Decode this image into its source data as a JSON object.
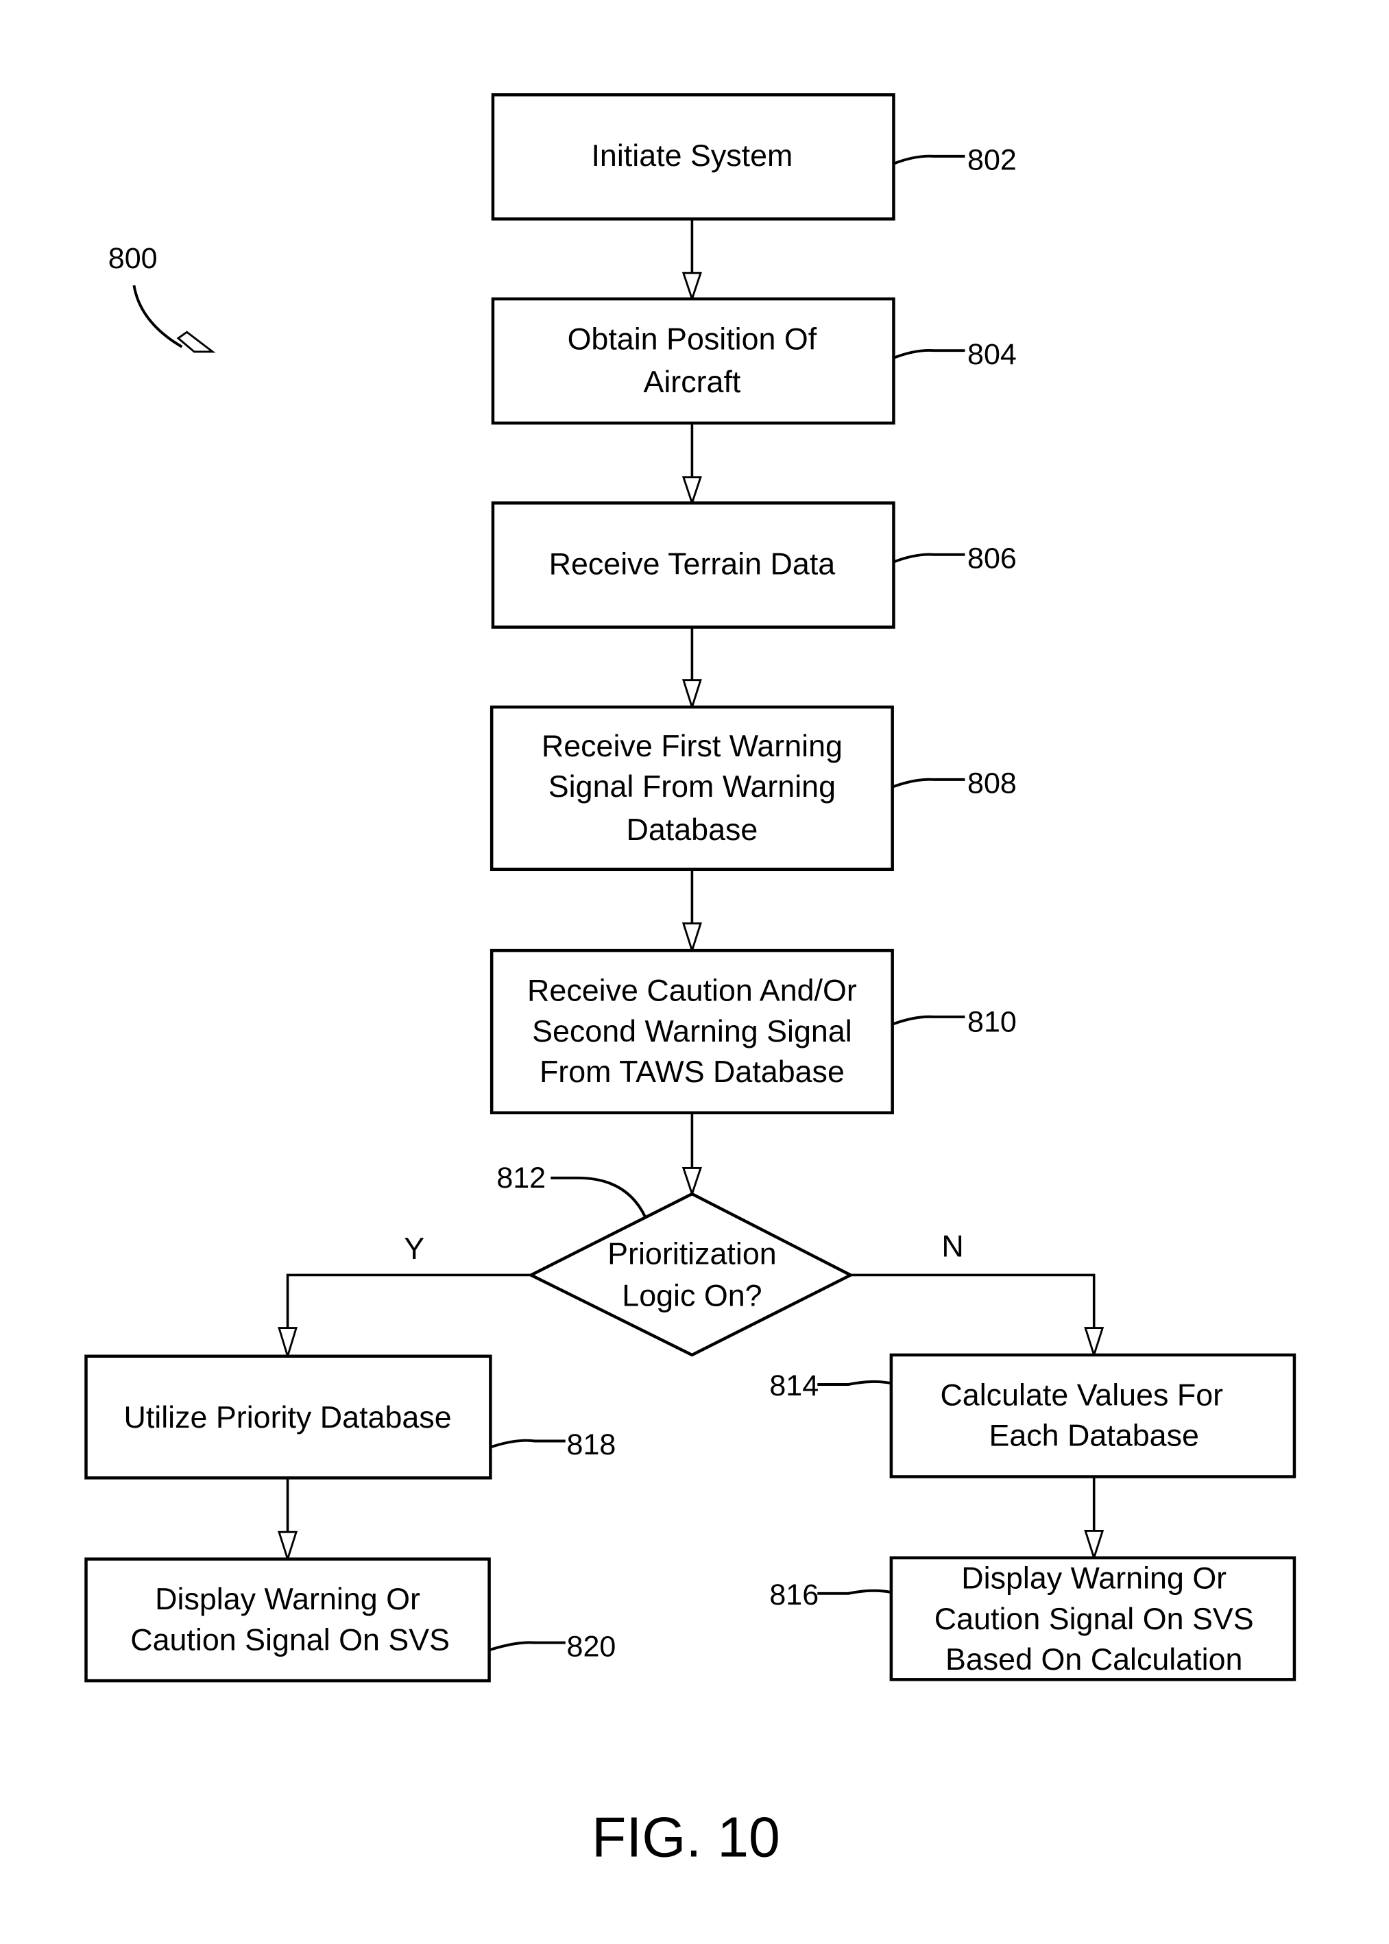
{
  "figure": {
    "label": "FIG. 10",
    "ref": "800"
  },
  "steps": {
    "s802": {
      "ref": "802",
      "lines": [
        "Initiate System"
      ]
    },
    "s804": {
      "ref": "804",
      "lines": [
        "Obtain Position Of",
        "Aircraft"
      ]
    },
    "s806": {
      "ref": "806",
      "lines": [
        "Receive Terrain Data"
      ]
    },
    "s808": {
      "ref": "808",
      "lines": [
        "Receive First Warning",
        "Signal From Warning",
        "Database"
      ]
    },
    "s810": {
      "ref": "810",
      "lines": [
        "Receive Caution And/Or",
        "Second Warning Signal",
        "From TAWS Database"
      ]
    },
    "s812": {
      "ref": "812",
      "lines": [
        "Prioritization",
        "Logic On?"
      ],
      "yes_label": "Y",
      "no_label": "N"
    },
    "s814": {
      "ref": "814",
      "lines": [
        "Calculate Values For",
        "Each Database"
      ]
    },
    "s816": {
      "ref": "816",
      "lines": [
        "Display Warning Or",
        "Caution Signal On SVS",
        "Based On Calculation"
      ]
    },
    "s818": {
      "ref": "818",
      "lines": [
        "Utilize Priority Database"
      ]
    },
    "s820": {
      "ref": "820",
      "lines": [
        "Display Warning Or",
        "Caution Signal On SVS"
      ]
    }
  }
}
